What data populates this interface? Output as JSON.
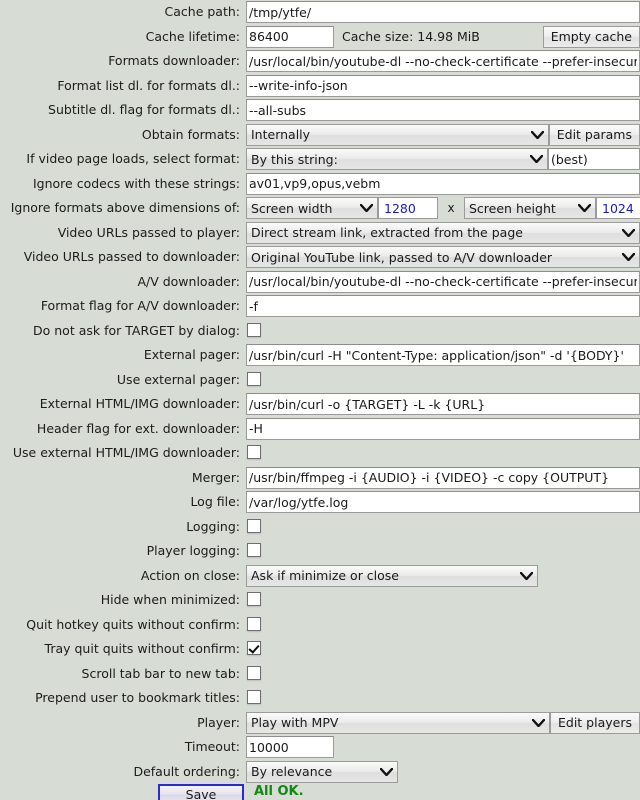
{
  "window": {
    "background_color": "#d7dcd5",
    "status": "All OK.",
    "status_color": "#118811"
  },
  "icons": {
    "chevron_down": "chevron-down-icon",
    "checkbox_check": "check-icon"
  },
  "buttons": {
    "empty_cache": "Empty cache",
    "edit_params": "Edit params",
    "edit_players": "Edit players",
    "save": "Save"
  },
  "rows": [
    {
      "label": "Cache path:",
      "type": "text",
      "value": "/tmp/ytfe/"
    },
    {
      "label": "Cache lifetime:",
      "type": "text-small-info-button",
      "value": "86400",
      "info": "Cache size: 14.98 MiB",
      "button": "Empty cache"
    },
    {
      "label": "Formats downloader:",
      "type": "text",
      "value": "/usr/local/bin/youtube-dl --no-check-certificate --prefer-insecure"
    },
    {
      "label": "Format list dl. for formats dl.:",
      "type": "text",
      "value": "--write-info-json"
    },
    {
      "label": "Subtitle dl. flag for formats dl.:",
      "type": "text",
      "value": "--all-subs"
    },
    {
      "label": "Obtain formats:",
      "type": "select-button",
      "value": "Internally",
      "button": "Edit params"
    },
    {
      "label": "If video page loads, select format:",
      "type": "select-text",
      "value": "By this string:",
      "text": "(best)"
    },
    {
      "label": "Ignore codecs with these strings:",
      "type": "text",
      "value": "av01,vp9,opus,vebm"
    },
    {
      "label": "Ignore formats above dimensions of:",
      "type": "dimensions",
      "width_mode": "Screen width",
      "width_value": "1280",
      "separator": "x",
      "height_mode": "Screen height",
      "height_value": "1024"
    },
    {
      "label": "Video URLs passed to player:",
      "type": "select",
      "value": "Direct stream link, extracted from the page"
    },
    {
      "label": "Video URLs passed to downloader:",
      "type": "select",
      "value": "Original YouTube link, passed to A/V downloader"
    },
    {
      "label": "A/V downloader:",
      "type": "text",
      "value": "/usr/local/bin/youtube-dl --no-check-certificate --prefer-insecure"
    },
    {
      "label": "Format flag for A/V downloader:",
      "type": "text",
      "value": "-f"
    },
    {
      "label": "Do not ask for TARGET by dialog:",
      "type": "checkbox",
      "checked": false
    },
    {
      "label": "External pager:",
      "type": "text",
      "value": "/usr/bin/curl -H \"Content-Type: application/json\" -d '{BODY}'"
    },
    {
      "label": "Use external pager:",
      "type": "checkbox",
      "checked": false
    },
    {
      "label": "External HTML/IMG downloader:",
      "type": "text",
      "value": "/usr/bin/curl -o {TARGET} -L -k {URL}"
    },
    {
      "label": "Header flag for ext. downloader:",
      "type": "text",
      "value": "-H"
    },
    {
      "label": "Use external HTML/IMG downloader:",
      "type": "checkbox",
      "checked": false
    },
    {
      "label": "Merger:",
      "type": "text",
      "value": "/usr/bin/ffmpeg -i {AUDIO} -i {VIDEO} -c copy {OUTPUT}"
    },
    {
      "label": "Log file:",
      "type": "text",
      "value": "/var/log/ytfe.log"
    },
    {
      "label": "Logging:",
      "type": "checkbox",
      "checked": false
    },
    {
      "label": "Player logging:",
      "type": "checkbox",
      "checked": false
    },
    {
      "label": "Action on close:",
      "type": "select-mid",
      "value": "Ask if minimize or close"
    },
    {
      "label": "Hide when minimized:",
      "type": "checkbox",
      "checked": false
    },
    {
      "label": "Quit hotkey quits without confirm:",
      "type": "checkbox",
      "checked": false
    },
    {
      "label": "Tray quit quits without confirm:",
      "type": "checkbox",
      "checked": true
    },
    {
      "label": "Scroll tab bar to new tab:",
      "type": "checkbox",
      "checked": false
    },
    {
      "label": "Prepend user to bookmark titles:",
      "type": "checkbox",
      "checked": false
    },
    {
      "label": "Player:",
      "type": "select-button",
      "value": "Play with MPV",
      "button": "Edit players"
    },
    {
      "label": "Timeout:",
      "type": "text-small",
      "value": "10000"
    },
    {
      "label": "Default ordering:",
      "type": "select-short",
      "value": "By relevance"
    }
  ]
}
